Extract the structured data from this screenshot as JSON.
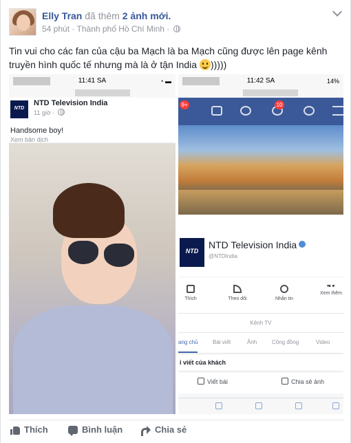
{
  "post": {
    "author": "Elly Tran",
    "action": "đã thêm",
    "action_link": "2 ảnh mới.",
    "time": "54 phút",
    "location": "Thành phố Hồ Chí Minh",
    "text": "Tin vui cho các fan của cậu ba Mạch là ba Mạch cũng được lên page kênh truyền hình quốc tế nhưng mà là ở tận India",
    "text_suffix": ")))))"
  },
  "photo_left": {
    "status_time": "11:41 SA",
    "logo_text": "NTD",
    "page_name": "NTD Television India",
    "post_time": "11 giờ ·",
    "caption": "Handsome boy!",
    "translate": "Xem bản dịch"
  },
  "photo_right": {
    "status_time": "11:42 SA",
    "battery": "14%",
    "notif_badge": "9+",
    "globe_badge": "10",
    "logo_text": "NTD",
    "page_name": "NTD Television India",
    "handle": "@NTDIndia",
    "actions": [
      "Thích",
      "Theo dõi",
      "Nhắn tin",
      "Xem thêm"
    ],
    "channel_label": "Kênh TV",
    "tabs": [
      "ang chủ",
      "Bài viết",
      "Ảnh",
      "Cộng đồng",
      "Video"
    ],
    "posts_heading": "i viết của khách",
    "composer_post": "Viết bài",
    "composer_photo": "Chia sẻ ảnh"
  },
  "footer": {
    "like": "Thích",
    "comment": "Bình luận",
    "share": "Chia sẻ"
  }
}
